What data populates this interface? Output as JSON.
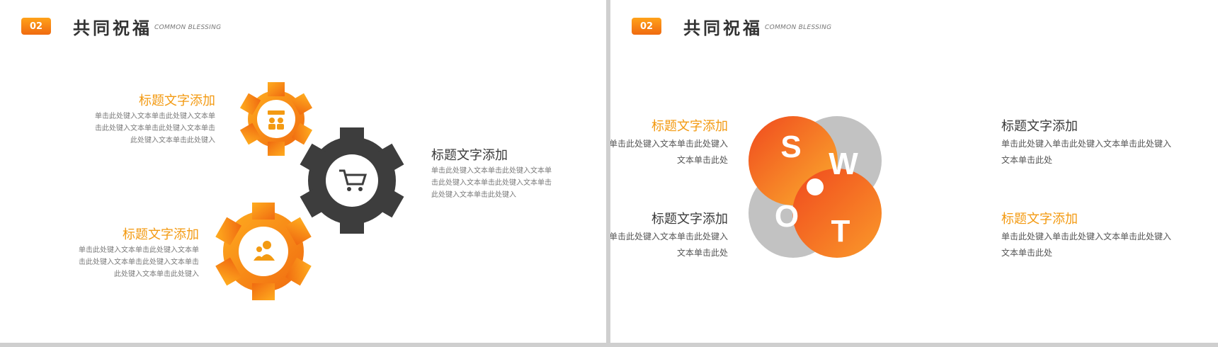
{
  "slides": [
    {
      "badge": "02",
      "title": "共同祝福",
      "subtitle": "COMMON BLESSING",
      "blocks": [
        {
          "title": "标题文字添加",
          "body": "单击此处键入文本单击此处键入文本单击此处键入文本单击此处键入文本单击此处键入文本单击此处键入"
        },
        {
          "title": "标题文字添加",
          "body": "单击此处键入文本单击此处键入文本单击此处键入文本单击此处键入文本单击此处键入文本单击此处键入"
        },
        {
          "title": "标题文字添加",
          "body": "单击此处键入文本单击此处键入文本单击此处键入文本单击此处键入文本单击此处键入文本单击此处键入"
        }
      ],
      "gear_icons": [
        "team-icon",
        "cart-icon",
        "people-icon"
      ]
    },
    {
      "badge": "02",
      "title": "共同祝福",
      "subtitle": "COMMON BLESSING",
      "swot_letters": [
        "S",
        "W",
        "O",
        "T"
      ],
      "blocks": [
        {
          "title": "标题文字添加",
          "body": "单击此处键入单击此处键入文本单击此处键入文本单击此处"
        },
        {
          "title": "标题文字添加",
          "body": "单击此处键入单击此处键入文本单击此处键入文本单击此处"
        },
        {
          "title": "标题文字添加",
          "body": "单击此处键入单击此处键入文本单击此处键入文本单击此处"
        },
        {
          "title": "标题文字添加",
          "body": "单击此处键入单击此处键入文本单击此处键入文本单击此处"
        }
      ]
    }
  ],
  "colors": {
    "orange": "#f39a12",
    "orange_dark": "#f0531e",
    "gear_dark": "#3d3d3d",
    "grey": "#c2c2c2"
  }
}
